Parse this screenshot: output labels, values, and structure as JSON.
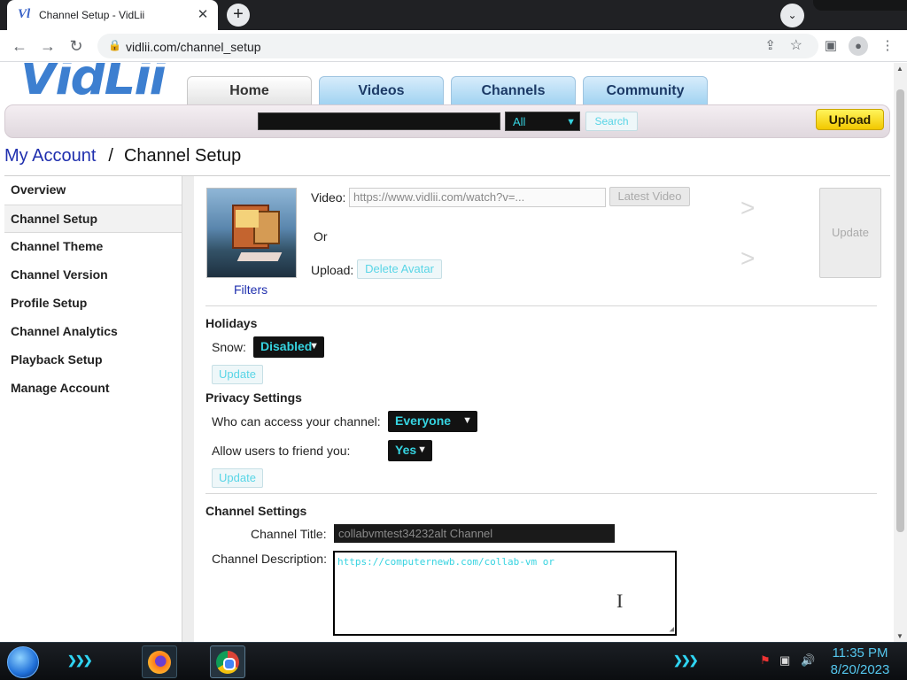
{
  "browser": {
    "tab_title": "Channel Setup - VidLii",
    "favicon_text": "Vl",
    "tab_close_glyph": "✕",
    "new_tab_glyph": "+",
    "tab_search_glyph": "⌄",
    "url": "vidlii.com/channel_setup",
    "back_glyph": "←",
    "forward_glyph": "→",
    "reload_glyph": "↻",
    "lock_glyph": "🔒",
    "share_glyph": "⇪",
    "star_glyph": "☆",
    "sidepanel_glyph": "▣",
    "profile_glyph": "●",
    "menu_glyph": "⋮"
  },
  "site": {
    "logo_text": "VidLii",
    "nav_tabs": [
      "Home",
      "Videos",
      "Channels",
      "Community"
    ],
    "search": {
      "category_selected": "All",
      "search_button": "Search",
      "upload_button": "Upload"
    }
  },
  "breadcrumb": {
    "parent": "My Account",
    "separator": "/",
    "current": "Channel Setup"
  },
  "sidebar": {
    "items": [
      {
        "label": "Overview"
      },
      {
        "label": "Channel Setup"
      },
      {
        "label": "Channel Theme"
      },
      {
        "label": "Channel Version"
      },
      {
        "label": "Profile Setup"
      },
      {
        "label": "Channel Analytics"
      },
      {
        "label": "Playback Setup"
      },
      {
        "label": "Manage Account"
      }
    ]
  },
  "avatar_section": {
    "filters_link": "Filters",
    "video_label": "Video:",
    "video_placeholder": "https://www.vidlii.com/watch?v=...",
    "latest_video_button": "Latest Video",
    "or_label": "Or",
    "upload_label": "Upload:",
    "delete_avatar_button": "Delete Avatar",
    "arrow_glyph": ">",
    "update_button": "Update"
  },
  "holidays": {
    "heading": "Holidays",
    "snow_label": "Snow:",
    "snow_value": "Disabled",
    "update_button": "Update"
  },
  "privacy": {
    "heading": "Privacy Settings",
    "access_label": "Who can access your channel:",
    "access_value": "Everyone",
    "friend_label": "Allow users to friend you:",
    "friend_value": "Yes",
    "update_button": "Update"
  },
  "channel_settings": {
    "heading": "Channel Settings",
    "title_label": "Channel Title:",
    "title_value": "collabvmtest34232alt Channel",
    "description_label": "Channel Description:",
    "description_value": "https://computernewb.com/collab-vm or"
  },
  "taskbar": {
    "time": "11:35 PM",
    "date": "8/20/2023",
    "chevrons": "❯❯❯"
  },
  "colors": {
    "accent_cyan": "#36d3e0",
    "link_blue": "#1f2fae",
    "upload_yellow": "#f2c800"
  }
}
